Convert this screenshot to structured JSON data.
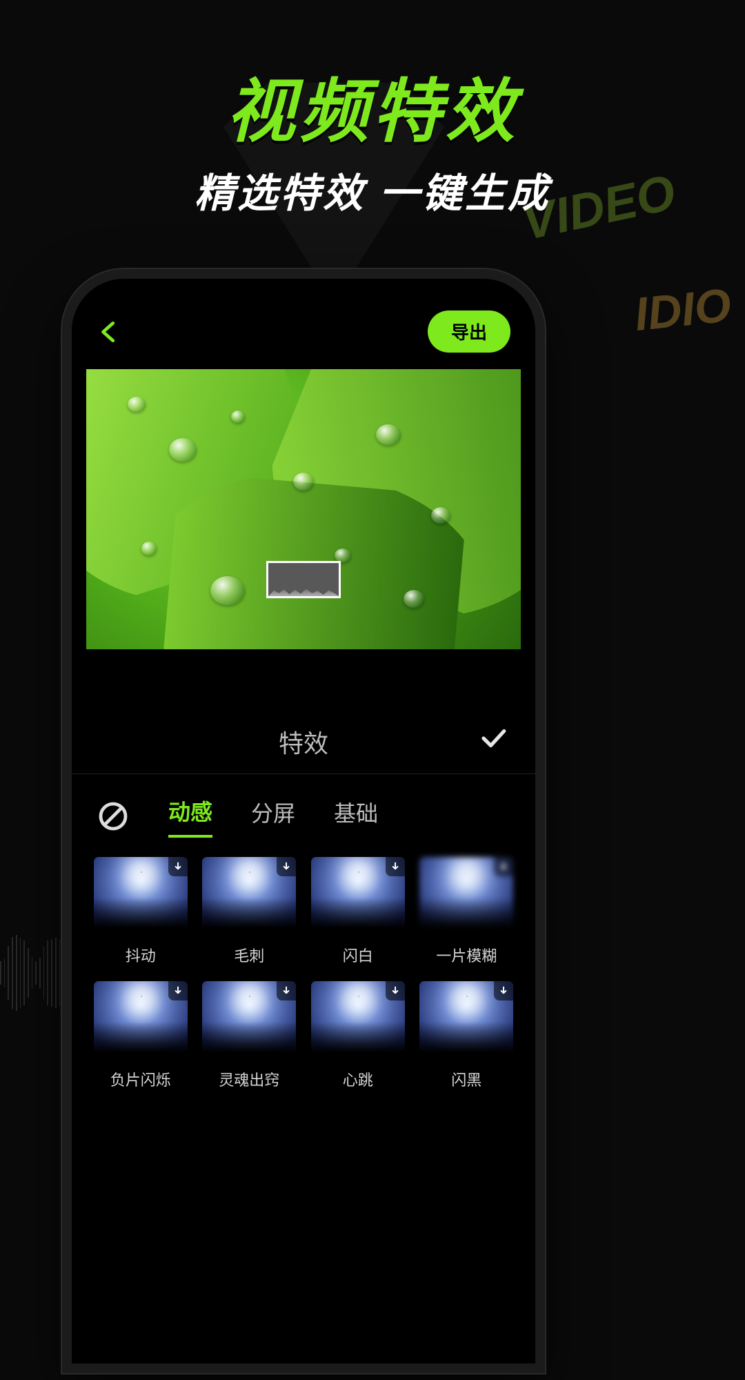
{
  "hero": {
    "title": "视频特效",
    "subtitle": "精选特效 一键生成"
  },
  "bg": {
    "video_text": "VIDEO",
    "idio_text": "IDIO"
  },
  "editor": {
    "export_label": "导出",
    "panel_title": "特效",
    "tabs": [
      {
        "label": "动感",
        "active": true
      },
      {
        "label": "分屏",
        "active": false
      },
      {
        "label": "基础",
        "active": false
      }
    ],
    "effects": [
      {
        "label": "抖动"
      },
      {
        "label": "毛刺"
      },
      {
        "label": "闪白"
      },
      {
        "label": "一片模糊",
        "blur": true
      },
      {
        "label": "负片闪烁"
      },
      {
        "label": "灵魂出窍"
      },
      {
        "label": "心跳"
      },
      {
        "label": "闪黑"
      }
    ]
  }
}
